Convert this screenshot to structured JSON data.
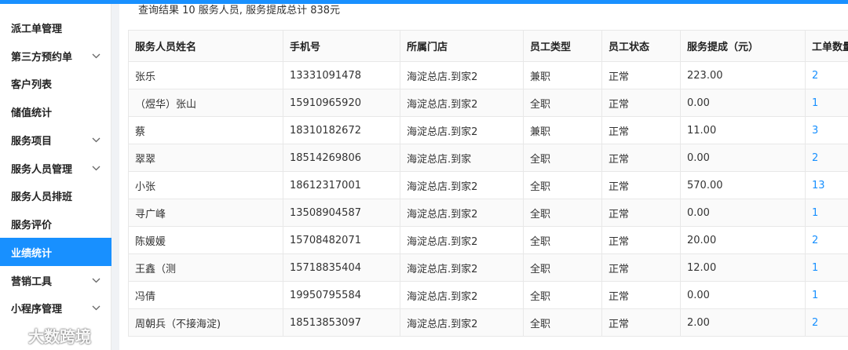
{
  "summary": "查询结果 10 服务人员, 服务提成总计 838元",
  "sidebar": {
    "items": [
      {
        "label": "派工单管理",
        "expandable": false,
        "active": false
      },
      {
        "label": "第三方预约单",
        "expandable": true,
        "active": false
      },
      {
        "label": "客户列表",
        "expandable": false,
        "active": false
      },
      {
        "label": "储值统计",
        "expandable": false,
        "active": false
      },
      {
        "label": "服务项目",
        "expandable": true,
        "active": false
      },
      {
        "label": "服务人员管理",
        "expandable": true,
        "active": false
      },
      {
        "label": "服务人员排班",
        "expandable": false,
        "active": false
      },
      {
        "label": "服务评价",
        "expandable": false,
        "active": false
      },
      {
        "label": "业绩统计",
        "expandable": false,
        "active": true
      },
      {
        "label": "营销工具",
        "expandable": true,
        "active": false
      },
      {
        "label": "小程序管理",
        "expandable": true,
        "active": false
      }
    ]
  },
  "watermark": "大数跨境",
  "table": {
    "columns": [
      "服务人员姓名",
      "手机号",
      "所属门店",
      "员工类型",
      "员工状态",
      "服务提成（元）",
      "工单数量"
    ],
    "rows": [
      [
        "张乐",
        "13331091478",
        "海淀总店.到家2",
        "兼职",
        "正常",
        "223.00",
        "2"
      ],
      [
        "（煜华）张山",
        "15910965920",
        "海淀总店.到家2",
        "全职",
        "正常",
        "0.00",
        "1"
      ],
      [
        "蔡",
        "18310182672",
        "海淀总店.到家2",
        "兼职",
        "正常",
        "11.00",
        "3"
      ],
      [
        "翠翠",
        "18514269806",
        "海淀总店.到家",
        "全职",
        "正常",
        "0.00",
        "2"
      ],
      [
        "小张",
        "18612317001",
        "海淀总店.到家2",
        "全职",
        "正常",
        "570.00",
        "13"
      ],
      [
        "寻广峰",
        "13508904587",
        "海淀总店.到家2",
        "全职",
        "正常",
        "0.00",
        "1"
      ],
      [
        "陈媛媛",
        "15708482071",
        "海淀总店.到家2",
        "全职",
        "正常",
        "20.00",
        "2"
      ],
      [
        "王鑫（测",
        "15718835404",
        "海淀总店.到家2",
        "全职",
        "正常",
        "12.00",
        "1"
      ],
      [
        "冯倩",
        "19950795584",
        "海淀总店.到家2",
        "全职",
        "正常",
        "0.00",
        "1"
      ],
      [
        "周朝兵（不接海淀)",
        "18513853097",
        "海淀总店.到家2",
        "全职",
        "正常",
        "2.00",
        "2"
      ]
    ]
  },
  "colors": {
    "accent": "#1890ff",
    "stripe": "#fafafa",
    "border": "#e8e8e8"
  }
}
